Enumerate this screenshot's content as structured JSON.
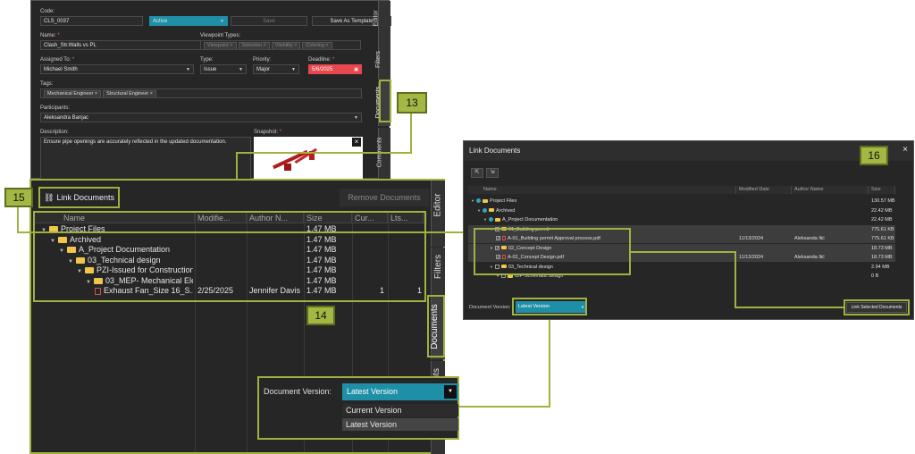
{
  "form": {
    "code_label": "Code:",
    "code_value": "CLS_0037",
    "status_value": "Active",
    "save_label": "Save",
    "save_template_label": "Save As Template",
    "name_label": "Name:",
    "name_value": "Clash_Str.Walls vs PL",
    "viewpoint_types_label": "Viewpoint Types:",
    "viewpoint_types": [
      "Viewpoint",
      "Selection",
      "Visibility",
      "Coloring"
    ],
    "assigned_label": "Assigned To:",
    "assigned_value": "Michael Smith",
    "type_label": "Type:",
    "type_value": "Issue",
    "priority_label": "Priority:",
    "priority_value": "Major",
    "deadline_label": "Deadline:",
    "deadline_value": "5/6/2025",
    "tags_label": "Tags:",
    "tags": [
      "Mechanical Engineer",
      "Structural Engineer"
    ],
    "participants_label": "Participants:",
    "participants_value": "Aleksandra Banjac",
    "description_label": "Description:",
    "description_value": "Ensure pipe openings are accurately reflected in the updated documentation.",
    "snapshot_label": "Snapshot:",
    "close_glyph": "×"
  },
  "side_tabs": {
    "editor": "Editor",
    "filters": "Filters",
    "documents": "Documents",
    "comments": "Comments",
    "comments_partial": "ents"
  },
  "callouts": {
    "c13": "13",
    "c14": "14",
    "c15": "15",
    "c16": "16"
  },
  "docs_panel": {
    "link_label": "Link Documents",
    "remove_label": "Remove Documents",
    "columns": [
      "Name",
      "Modifie...",
      "Author N...",
      "Size",
      "Cur...",
      "Lts..."
    ],
    "rows": [
      {
        "indent": 0,
        "kind": "folder",
        "name": "Project Files",
        "modified": "",
        "author": "",
        "size": "1.47 MB",
        "cur": "",
        "lts": ""
      },
      {
        "indent": 1,
        "kind": "folder",
        "name": "Archived",
        "modified": "",
        "author": "",
        "size": "1.47 MB",
        "cur": "",
        "lts": ""
      },
      {
        "indent": 2,
        "kind": "folder",
        "name": "A_Project Documentation",
        "modified": "",
        "author": "",
        "size": "1.47 MB",
        "cur": "",
        "lts": ""
      },
      {
        "indent": 3,
        "kind": "folder",
        "name": "03_Technical design",
        "modified": "",
        "author": "",
        "size": "1.47 MB",
        "cur": "",
        "lts": ""
      },
      {
        "indent": 4,
        "kind": "folder",
        "name": "PZI-Issued for Construction...",
        "modified": "",
        "author": "",
        "size": "1.47 MB",
        "cur": "",
        "lts": ""
      },
      {
        "indent": 5,
        "kind": "folder",
        "name": "03_MEP- Mechanical Ele...",
        "modified": "",
        "author": "",
        "size": "1.47 MB",
        "cur": "",
        "lts": ""
      },
      {
        "indent": 6,
        "kind": "file",
        "name": "Exhaust Fan_Size 16_S...",
        "modified": "2/25/2025",
        "author": "Jennifer Davis",
        "size": "1.47 MB",
        "cur": "1",
        "lts": "1"
      }
    ]
  },
  "version_popup": {
    "label": "Document Version:",
    "selected": "Latest Version",
    "options": [
      "Current Version",
      "Latest Version"
    ]
  },
  "link_dialog": {
    "title": "Link Documents",
    "close_glyph": "×",
    "columns": [
      "Name",
      "Modified Date",
      "Author Name",
      "Size"
    ],
    "rows": [
      {
        "indent": 0,
        "kind": "folder",
        "check": "radio",
        "name": "Project Files",
        "modified": "",
        "author": "",
        "size": "130.57 MB",
        "hl": false
      },
      {
        "indent": 1,
        "kind": "folder",
        "check": "radio",
        "name": "Archived",
        "modified": "",
        "author": "",
        "size": "22.42 MB",
        "hl": false
      },
      {
        "indent": 2,
        "kind": "folder",
        "check": "radio",
        "name": "A_Project Documentation",
        "modified": "",
        "author": "",
        "size": "22.42 MB",
        "hl": false
      },
      {
        "indent": 3,
        "kind": "folder",
        "check": "on",
        "name": "01_Building permit",
        "modified": "",
        "author": "",
        "size": "775.61 KB",
        "hl": true
      },
      {
        "indent": 4,
        "kind": "file",
        "check": "on",
        "name": "A-01_Building permit Approval process.pdf",
        "modified": "11/13/2024",
        "author": "Aleksanda Ilić",
        "size": "775.61 KB",
        "hl": true
      },
      {
        "indent": 3,
        "kind": "folder",
        "check": "on",
        "name": "02_Concept Design",
        "modified": "",
        "author": "",
        "size": "18.73 MB",
        "hl": true
      },
      {
        "indent": 4,
        "kind": "file",
        "check": "on",
        "name": "A-02_Concept Design.pdf",
        "modified": "11/13/2024",
        "author": "Aleksanda Ilić",
        "size": "18.73 MB",
        "hl": true
      },
      {
        "indent": 3,
        "kind": "folder",
        "check": "off",
        "name": "03_Technical design",
        "modified": "",
        "author": "",
        "size": "2.94 MB",
        "hl": false
      },
      {
        "indent": 4,
        "kind": "folder",
        "check": "off",
        "name": "IDP-Schematic design",
        "modified": "",
        "author": "",
        "size": "0 B",
        "hl": false
      }
    ],
    "version_label": "Document Version:",
    "version_value": "Latest Version",
    "link_selected_label": "Link Selected Documents",
    "toolbar_glyphs": [
      "⇱",
      "⇲"
    ]
  },
  "colors": {
    "accent": "#1f8fa8",
    "callout": "#a3b744",
    "danger": "#e8474f"
  }
}
